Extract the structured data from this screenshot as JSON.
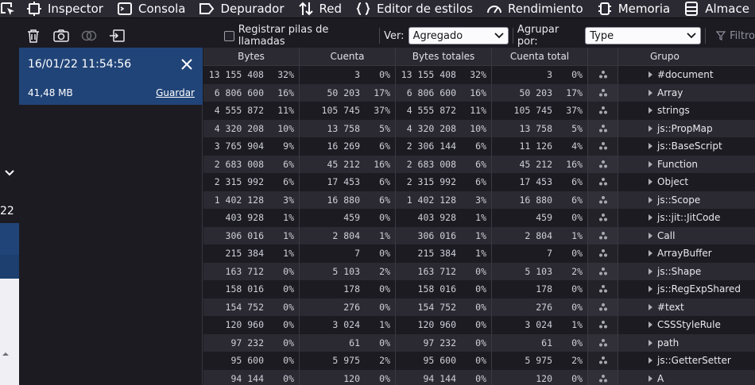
{
  "tabs": [
    {
      "label": "Inspector",
      "icon": "inspector-icon"
    },
    {
      "label": "Consola",
      "icon": "console-icon"
    },
    {
      "label": "Depurador",
      "icon": "debugger-icon"
    },
    {
      "label": "Red",
      "icon": "network-icon"
    },
    {
      "label": "Editor de estilos",
      "icon": "style-editor-icon"
    },
    {
      "label": "Rendimiento",
      "icon": "performance-icon"
    },
    {
      "label": "Memoria",
      "icon": "memory-icon",
      "selected": true
    },
    {
      "label": "Almace",
      "icon": "storage-icon"
    }
  ],
  "toolbar": {
    "record_stacks_label": "Registrar pilas de llamadas",
    "view_label": "Ver:",
    "view_value": "Agregado",
    "group_label": "Agrupar por:",
    "group_value": "Type",
    "filter_placeholder": "Filtro"
  },
  "strip": {
    "number": "22"
  },
  "snapshot": {
    "date": "16/01/22 11:54:56",
    "size": "41,48 MB",
    "save_label": "Guardar"
  },
  "columns": [
    "Bytes",
    "Cuenta",
    "Bytes totales",
    "Cuenta total",
    "",
    "Grupo"
  ],
  "rows": [
    {
      "bytes": "13 155 408",
      "bytes_pct": "32%",
      "count": "3",
      "count_pct": "0%",
      "total_bytes": "13 155 408",
      "total_bytes_pct": "32%",
      "total_count": "3",
      "total_count_pct": "0%",
      "group": "#document"
    },
    {
      "bytes": "6 806 600",
      "bytes_pct": "16%",
      "count": "50 203",
      "count_pct": "17%",
      "total_bytes": "6 806 600",
      "total_bytes_pct": "16%",
      "total_count": "50 203",
      "total_count_pct": "17%",
      "group": "Array"
    },
    {
      "bytes": "4 555 872",
      "bytes_pct": "11%",
      "count": "105 745",
      "count_pct": "37%",
      "total_bytes": "4 555 872",
      "total_bytes_pct": "11%",
      "total_count": "105 745",
      "total_count_pct": "37%",
      "group": "strings"
    },
    {
      "bytes": "4 320 208",
      "bytes_pct": "10%",
      "count": "13 758",
      "count_pct": "5%",
      "total_bytes": "4 320 208",
      "total_bytes_pct": "10%",
      "total_count": "13 758",
      "total_count_pct": "5%",
      "group": "js::PropMap"
    },
    {
      "bytes": "3 765 904",
      "bytes_pct": "9%",
      "count": "16 269",
      "count_pct": "6%",
      "total_bytes": "2 306 144",
      "total_bytes_pct": "6%",
      "total_count": "11 126",
      "total_count_pct": "4%",
      "group": "js::BaseScript"
    },
    {
      "bytes": "2 683 008",
      "bytes_pct": "6%",
      "count": "45 212",
      "count_pct": "16%",
      "total_bytes": "2 683 008",
      "total_bytes_pct": "6%",
      "total_count": "45 212",
      "total_count_pct": "16%",
      "group": "Function"
    },
    {
      "bytes": "2 315 992",
      "bytes_pct": "6%",
      "count": "17 453",
      "count_pct": "6%",
      "total_bytes": "2 315 992",
      "total_bytes_pct": "6%",
      "total_count": "17 453",
      "total_count_pct": "6%",
      "group": "Object"
    },
    {
      "bytes": "1 402 128",
      "bytes_pct": "3%",
      "count": "16 880",
      "count_pct": "6%",
      "total_bytes": "1 402 128",
      "total_bytes_pct": "3%",
      "total_count": "16 880",
      "total_count_pct": "6%",
      "group": "js::Scope"
    },
    {
      "bytes": "403 928",
      "bytes_pct": "1%",
      "count": "459",
      "count_pct": "0%",
      "total_bytes": "403 928",
      "total_bytes_pct": "1%",
      "total_count": "459",
      "total_count_pct": "0%",
      "group": "js::jit::JitCode"
    },
    {
      "bytes": "306 016",
      "bytes_pct": "1%",
      "count": "2 804",
      "count_pct": "1%",
      "total_bytes": "306 016",
      "total_bytes_pct": "1%",
      "total_count": "2 804",
      "total_count_pct": "1%",
      "group": "Call"
    },
    {
      "bytes": "215 384",
      "bytes_pct": "1%",
      "count": "7",
      "count_pct": "0%",
      "total_bytes": "215 384",
      "total_bytes_pct": "1%",
      "total_count": "7",
      "total_count_pct": "0%",
      "group": "ArrayBuffer"
    },
    {
      "bytes": "163 712",
      "bytes_pct": "0%",
      "count": "5 103",
      "count_pct": "2%",
      "total_bytes": "163 712",
      "total_bytes_pct": "0%",
      "total_count": "5 103",
      "total_count_pct": "2%",
      "group": "js::Shape"
    },
    {
      "bytes": "158 016",
      "bytes_pct": "0%",
      "count": "178",
      "count_pct": "0%",
      "total_bytes": "158 016",
      "total_bytes_pct": "0%",
      "total_count": "178",
      "total_count_pct": "0%",
      "group": "js::RegExpShared"
    },
    {
      "bytes": "154 752",
      "bytes_pct": "0%",
      "count": "276",
      "count_pct": "0%",
      "total_bytes": "154 752",
      "total_bytes_pct": "0%",
      "total_count": "276",
      "total_count_pct": "0%",
      "group": "#text"
    },
    {
      "bytes": "120 960",
      "bytes_pct": "0%",
      "count": "3 024",
      "count_pct": "1%",
      "total_bytes": "120 960",
      "total_bytes_pct": "0%",
      "total_count": "3 024",
      "total_count_pct": "1%",
      "group": "CSSStyleRule"
    },
    {
      "bytes": "97 232",
      "bytes_pct": "0%",
      "count": "61",
      "count_pct": "0%",
      "total_bytes": "97 232",
      "total_bytes_pct": "0%",
      "total_count": "61",
      "total_count_pct": "0%",
      "group": "path"
    },
    {
      "bytes": "95 600",
      "bytes_pct": "0%",
      "count": "5 975",
      "count_pct": "2%",
      "total_bytes": "95 600",
      "total_bytes_pct": "0%",
      "total_count": "5 975",
      "total_count_pct": "2%",
      "group": "js::GetterSetter"
    },
    {
      "bytes": "94 144",
      "bytes_pct": "0%",
      "count": "120",
      "count_pct": "0%",
      "total_bytes": "94 144",
      "total_bytes_pct": "0%",
      "total_count": "120",
      "total_count_pct": "0%",
      "group": "A"
    }
  ]
}
